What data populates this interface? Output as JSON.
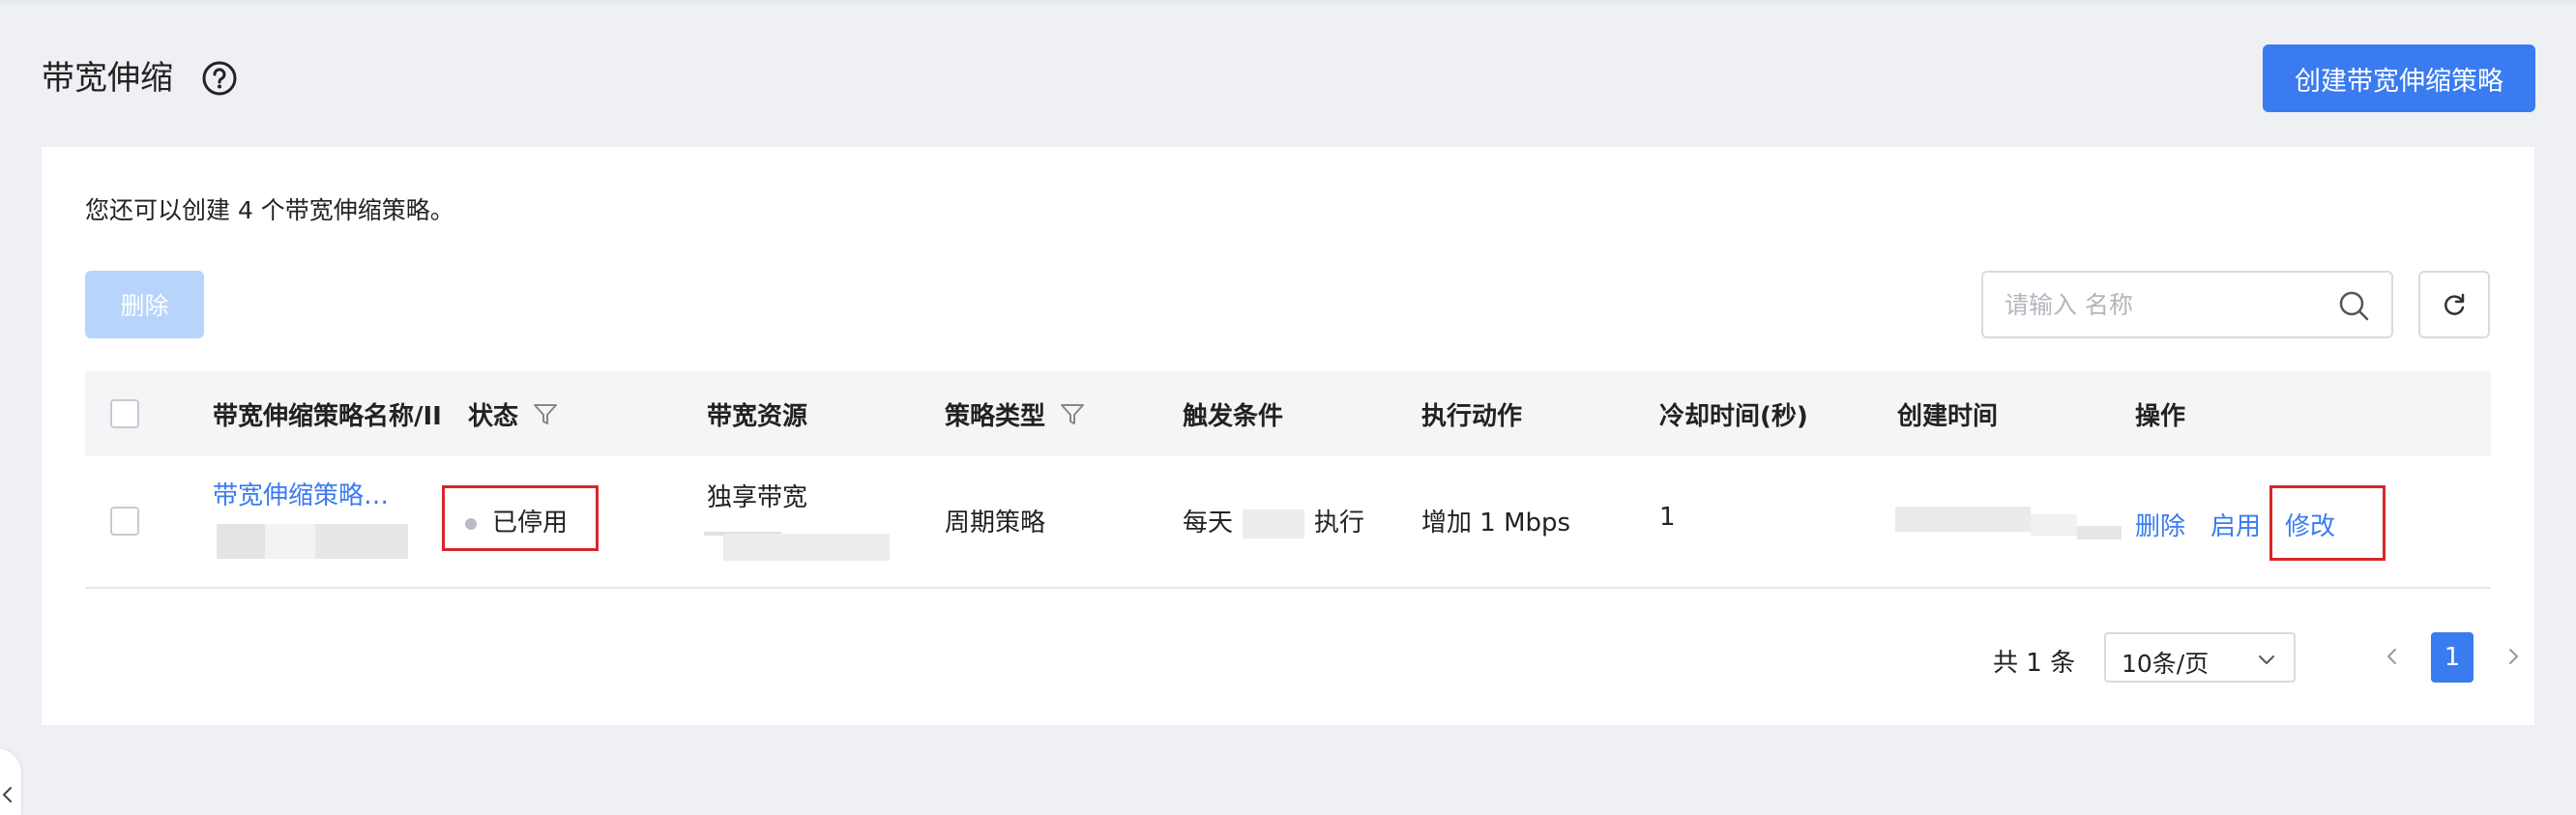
{
  "header": {
    "title": "带宽伸缩",
    "create_button": "创建带宽伸缩策略"
  },
  "card": {
    "notice": "您还可以创建 4 个带宽伸缩策略。",
    "delete_button": "删除",
    "search": {
      "placeholder": "请输入 名称",
      "value": ""
    }
  },
  "table": {
    "columns": [
      "带宽伸缩策略名称/II",
      "状态",
      "带宽资源",
      "策略类型",
      "触发条件",
      "执行动作",
      "冷却时间(秒)",
      "创建时间",
      "操作"
    ],
    "rows": [
      {
        "name": "带宽伸缩策略…",
        "status": "已停用",
        "resource": "独享带宽",
        "type": "周期策略",
        "trigger_prefix": "每天",
        "trigger_suffix": "执行",
        "action": "增加 1 Mbps",
        "cooldown": "1",
        "ops": [
          "删除",
          "启用",
          "修改"
        ]
      }
    ]
  },
  "pagination": {
    "total": "共 1 条",
    "page_size": "10条/页",
    "current_page": "1"
  },
  "colors": {
    "primary": "#3a7bf0",
    "disabled_button": "#b8d4fb",
    "highlight": "#d8262a"
  }
}
